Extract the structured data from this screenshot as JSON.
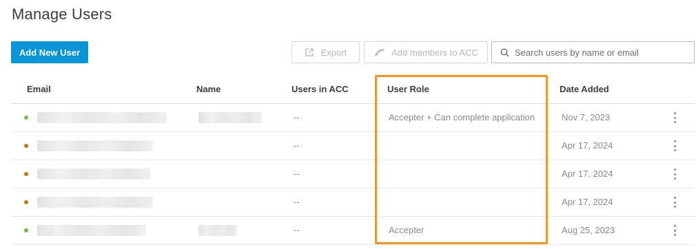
{
  "page": {
    "title": "Manage Users"
  },
  "toolbar": {
    "add_user_label": "Add New User",
    "export_label": "Export",
    "add_members_label": "Add members to ACC",
    "search_placeholder": "Search users by name or email"
  },
  "table": {
    "headers": {
      "email": "Email",
      "name": "Name",
      "users_in_acc": "Users in ACC",
      "user_role": "User Role",
      "date_added": "Date Added"
    },
    "rows": [
      {
        "status_color": "#7ab648",
        "users_in_acc": "--",
        "user_role": "Accepter + Can complete application",
        "date_added": "Nov 7, 2023"
      },
      {
        "status_color": "#c07a1a",
        "users_in_acc": "--",
        "user_role": "",
        "date_added": "Apr 17, 2024"
      },
      {
        "status_color": "#c07a1a",
        "users_in_acc": "--",
        "user_role": "",
        "date_added": "Apr 17, 2024"
      },
      {
        "status_color": "#c07a1a",
        "users_in_acc": "--",
        "user_role": "",
        "date_added": "Apr 17, 2024"
      },
      {
        "status_color": "#7ab648",
        "users_in_acc": "--",
        "user_role": "Accepter",
        "date_added": "Aug 25, 2023"
      }
    ]
  },
  "colors": {
    "primary": "#0696d7",
    "highlight": "#f7941d",
    "active": "#7ab648",
    "pending": "#c07a1a"
  },
  "icons": {
    "export": "export-icon",
    "acc": "acc-logo-icon",
    "search": "search-icon",
    "more": "more-vertical-icon"
  }
}
